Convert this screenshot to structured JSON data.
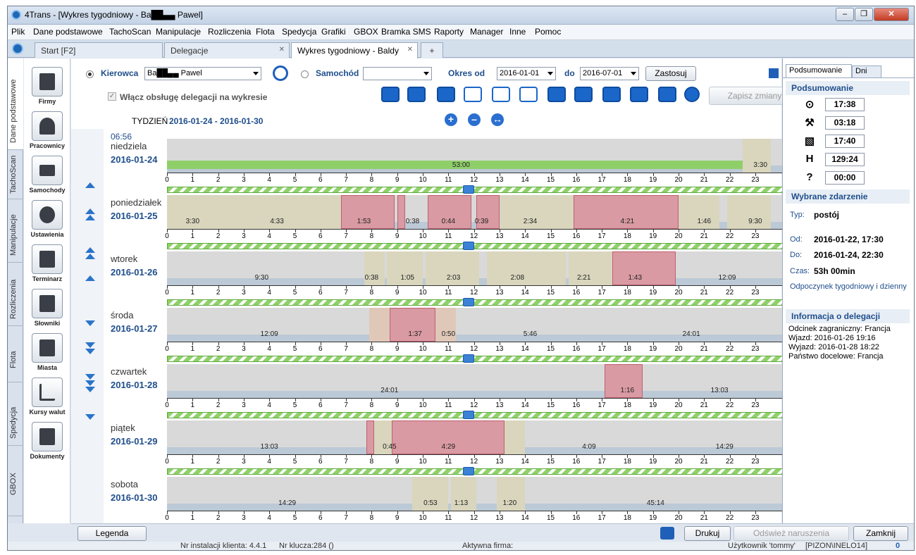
{
  "window": {
    "title": "4Trans - [Wykres tygodniowy - Ba██▄▄   Pawel]"
  },
  "menu": [
    "Plik",
    "Dane podstawowe",
    "TachoScan",
    "Manipulacje",
    "Rozliczenia",
    "Flota",
    "Spedycja",
    "Grafiki",
    "GBOX",
    "Bramka SMS",
    "Raporty",
    "Manager",
    "Inne",
    "Pomoc"
  ],
  "tabs": [
    {
      "label": "Start [F2]"
    },
    {
      "label": "Delegacje"
    },
    {
      "label": "Wykres tygodniowy - Baldy"
    }
  ],
  "lefttabs": [
    "Dane podstawowe",
    "TachoScan",
    "Manipulacje",
    "Rozliczenia",
    "Flota",
    "Spedycja",
    "GBOX"
  ],
  "nav": [
    "Firmy",
    "Pracownicy",
    "Samochody",
    "Ustawienia",
    "Terminarz",
    "Słowniki",
    "Miasta",
    "Kursy walut",
    "Dokumenty"
  ],
  "filters": {
    "driver_label": "Kierowca",
    "driver_value": "Ba██▄▄       Pawel",
    "vehicle_label": "Samochód",
    "vehicle_value": "",
    "period_label": "Okres od",
    "from": "2016-01-01",
    "to_label": "do",
    "to": "2016-07-01",
    "apply": "Zastosuj",
    "delegation_checkbox": "Włącz obsługę delegacji na wykresie",
    "save": "Zapisz zmiany"
  },
  "week": {
    "label": "TYDZIEŃ",
    "range": "2016-01-24 - 2016-01-30",
    "time": "06:56"
  },
  "ticks": [
    "0",
    "1",
    "2",
    "3",
    "4",
    "5",
    "6",
    "7",
    "8",
    "9",
    "10",
    "11",
    "12",
    "13",
    "14",
    "15",
    "16",
    "17",
    "18",
    "19",
    "20",
    "21",
    "22",
    "23"
  ],
  "days": [
    {
      "name": "niedziela",
      "date": "2016-01-24",
      "labels": [
        {
          "t": "53:00",
          "h": 11.5
        },
        {
          "t": "3:30",
          "h": 23.2
        }
      ]
    },
    {
      "name": "poniedziałek",
      "date": "2016-01-25",
      "labels": [
        {
          "t": "3:30",
          "h": 1.0
        },
        {
          "t": "4:33",
          "h": 4.3
        },
        {
          "t": "1:53",
          "h": 7.7
        },
        {
          "t": "0:38",
          "h": 9.6
        },
        {
          "t": "0:44",
          "h": 11.0
        },
        {
          "t": "0:39",
          "h": 12.3
        },
        {
          "t": "2:34",
          "h": 14.2
        },
        {
          "t": "4:21",
          "h": 18.0
        },
        {
          "t": "1:46",
          "h": 21.0
        },
        {
          "t": "9:30",
          "h": 23.0
        }
      ]
    },
    {
      "name": "wtorek",
      "date": "2016-01-26",
      "labels": [
        {
          "t": "9:30",
          "h": 3.7
        },
        {
          "t": "0:38",
          "h": 8.0
        },
        {
          "t": "1:05",
          "h": 9.4
        },
        {
          "t": "2:03",
          "h": 11.2
        },
        {
          "t": "2:08",
          "h": 13.7
        },
        {
          "t": "2:21",
          "h": 16.3
        },
        {
          "t": "1:43",
          "h": 18.3
        },
        {
          "t": "12:09",
          "h": 21.9
        }
      ]
    },
    {
      "name": "środa",
      "date": "2016-01-27",
      "labels": [
        {
          "t": "12:09",
          "h": 4.0
        },
        {
          "t": "1:37",
          "h": 9.7
        },
        {
          "t": "0:50",
          "h": 11.0
        },
        {
          "t": "5:46",
          "h": 14.2
        },
        {
          "t": "24:01",
          "h": 20.5
        }
      ]
    },
    {
      "name": "czwartek",
      "date": "2016-01-28",
      "labels": [
        {
          "t": "24:01",
          "h": 8.7
        },
        {
          "t": "1:16",
          "h": 18.0
        },
        {
          "t": "13:03",
          "h": 21.6
        }
      ]
    },
    {
      "name": "piątek",
      "date": "2016-01-29",
      "labels": [
        {
          "t": "13:03",
          "h": 4.0
        },
        {
          "t": "0:45",
          "h": 8.7
        },
        {
          "t": "4:29",
          "h": 11.0
        },
        {
          "t": "4:09",
          "h": 16.5
        },
        {
          "t": "14:29",
          "h": 21.8
        }
      ]
    },
    {
      "name": "sobota",
      "date": "2016-01-30",
      "labels": [
        {
          "t": "14:29",
          "h": 4.7
        },
        {
          "t": "0:53",
          "h": 10.3
        },
        {
          "t": "1:13",
          "h": 11.5
        },
        {
          "t": "1:20",
          "h": 13.4
        },
        {
          "t": "45:14",
          "h": 19.1
        }
      ]
    }
  ],
  "summary": {
    "tabs": [
      "Podsumowanie",
      "Dni"
    ],
    "header": "Podsumowanie",
    "values": [
      "17:38",
      "03:18",
      "17:40",
      "129:24",
      "00:00"
    ],
    "icons": [
      "⊙",
      "⚒",
      "▧",
      "H",
      "?"
    ]
  },
  "event": {
    "header": "Wybrane zdarzenie",
    "typ_label": "Typ:",
    "typ": "postój",
    "od_label": "Od:",
    "od": "2016-01-22, 17:30",
    "do_label": "Do:",
    "do": "2016-01-24, 22:30",
    "czas_label": "Czas:",
    "czas": "53h 00min",
    "desc": "Odpoczynek tygodniowy i dzienny"
  },
  "delegation": {
    "header": "Informacja o delegacji",
    "lines": [
      "Odcinek zagraniczny: Francja",
      "Wjazd: 2016-01-26 19:16",
      "Wyjazd: 2016-01-28 18:22",
      "Państwo docelowe: Francja"
    ]
  },
  "bottom": {
    "legend": "Legenda",
    "print": "Drukuj",
    "refresh": "Odśwież naruszenia",
    "close": "Zamknij"
  },
  "status": {
    "install": "Nr instalacji klienta: 4.4.1",
    "key": "Nr klucza:284 ()",
    "company": "Aktywna firma:",
    "user": "Użytkownik 'tommy'",
    "server": "[PIZON\\INELO14]",
    "count": "0"
  },
  "colors": {
    "accent": "#1f4e8c",
    "drive": "#d99aa3",
    "rest": "#d6d6d6",
    "delegation": "#8fd16a"
  }
}
